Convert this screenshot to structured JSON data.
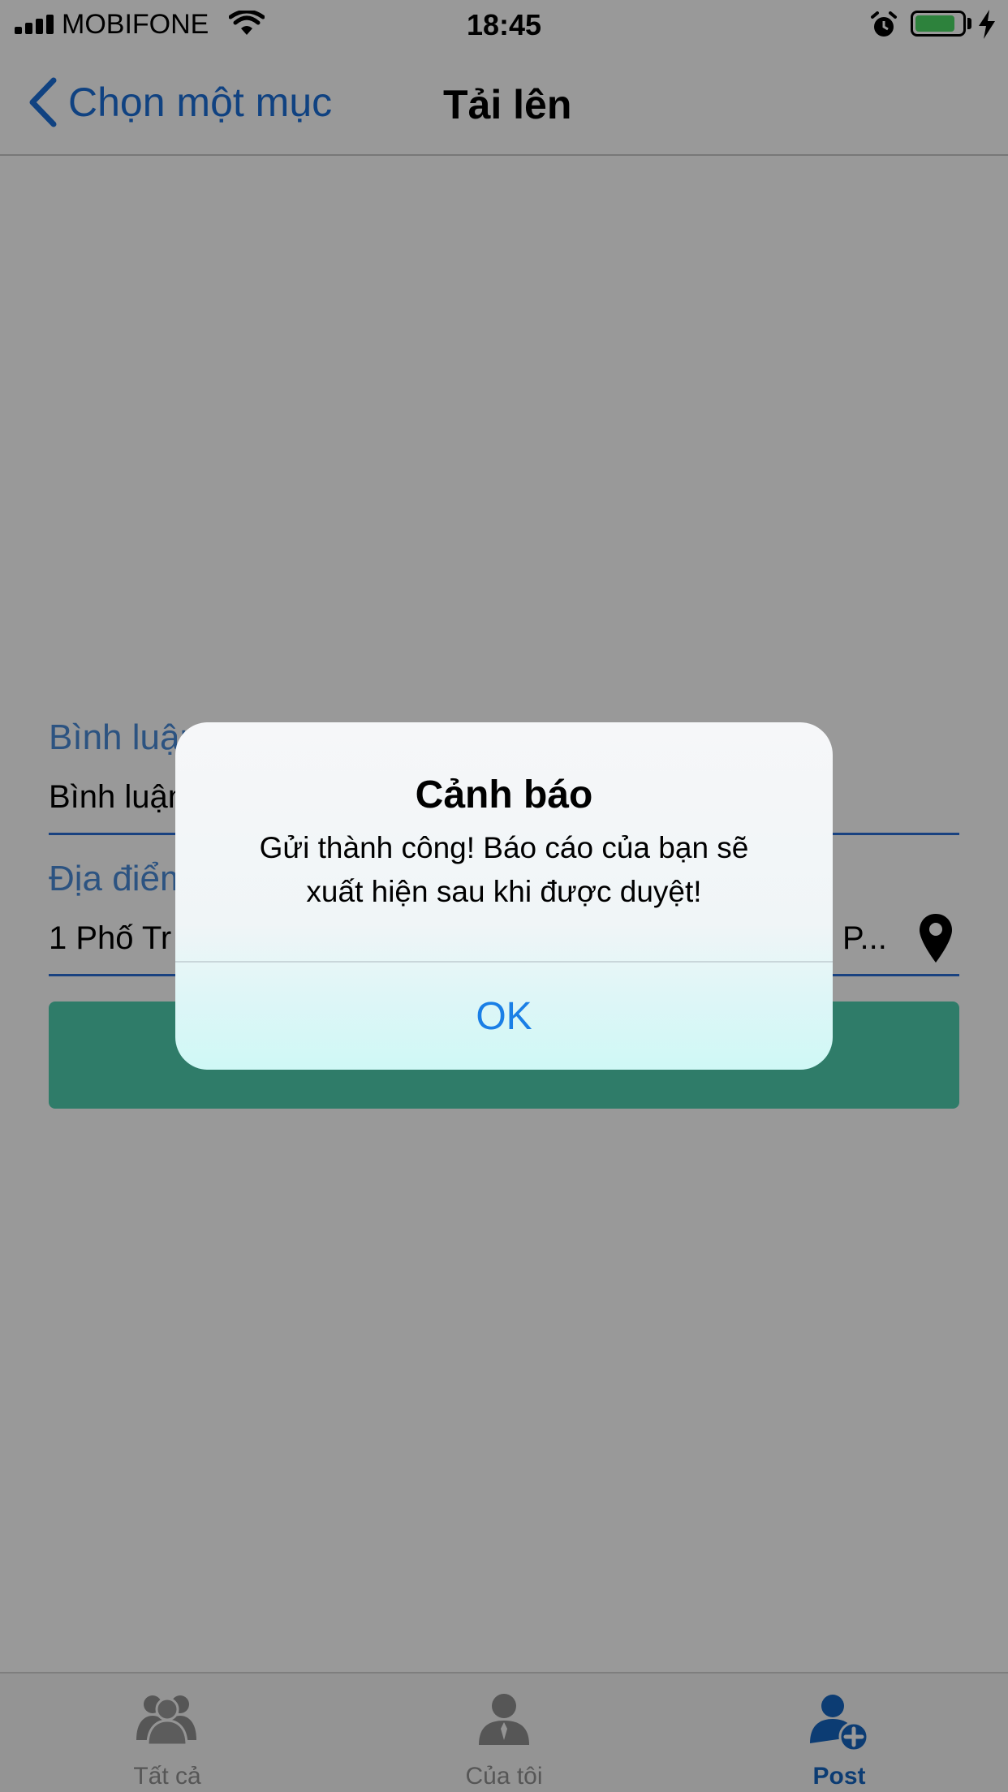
{
  "status_bar": {
    "carrier": "MOBIFONE",
    "time": "18:45",
    "battery_color": "#4cd964",
    "battery_level": 0.85
  },
  "nav": {
    "back_label": "Chọn một mục",
    "title": "Tải lên",
    "back_icon": "chevron-left-icon"
  },
  "form": {
    "comment": {
      "label": "Bình luận",
      "value": "Bình luận"
    },
    "location": {
      "label": "Địa điểm",
      "value": "1 Phố Tr",
      "value_tail": "P...",
      "icon": "map-pin-icon"
    },
    "submit_color": "#4fcfb0"
  },
  "alert": {
    "title": "Cảnh báo",
    "message_line1": "Gửi thành công! Báo cáo của bạn sẽ",
    "message_line2": "xuất hiện sau khi được duyệt!",
    "ok_label": "OK"
  },
  "tabs": [
    {
      "label": "Tất cả",
      "icon": "group-icon",
      "active": false
    },
    {
      "label": "Của tôi",
      "icon": "user-icon",
      "active": false
    },
    {
      "label": "Post",
      "icon": "user-add-icon",
      "active": true
    }
  ],
  "colors": {
    "accent": "#1c6fd8",
    "tab_inactive": "#8f8f8f",
    "tab_active": "#1565c0"
  }
}
